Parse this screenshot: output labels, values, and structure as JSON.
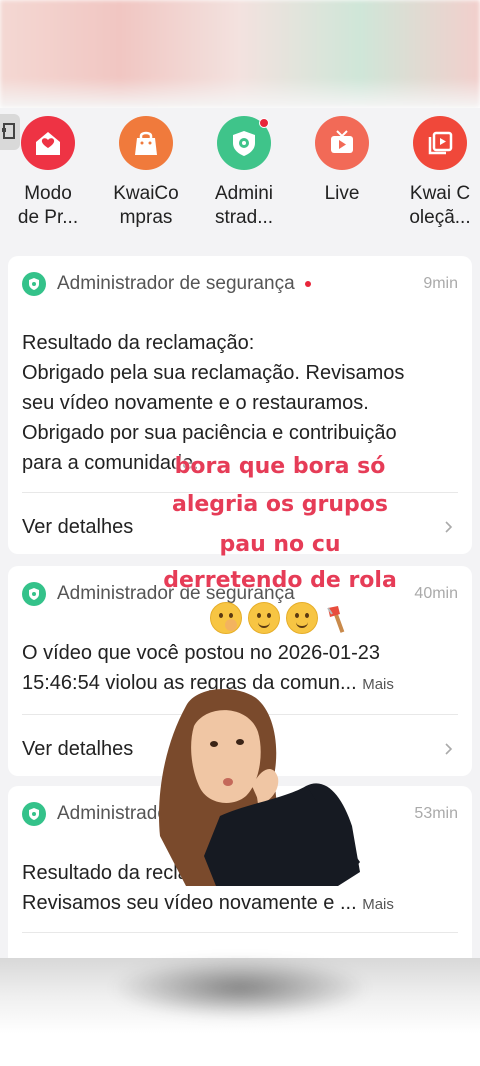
{
  "apps": [
    {
      "label": "Modo\nde Pr...",
      "icon": "home-shield-icon",
      "color": "#ee3344"
    },
    {
      "label": "KwaiCo\nmpras",
      "icon": "shopping-bag-icon",
      "color": "#f07a3c"
    },
    {
      "label": "Admini\nstrad...",
      "icon": "shield-icon",
      "color": "#3fc48a",
      "badge": true
    },
    {
      "label": "Live",
      "icon": "tv-icon",
      "color": "#f26a57"
    },
    {
      "label": "Kwai C\noleçã...",
      "icon": "video-collection-icon",
      "color": "#f0483a"
    }
  ],
  "cards": [
    {
      "title": "Administrador de segurança",
      "time": "9min",
      "unread": true,
      "body": [
        "Resultado da reclamação:",
        "Obrigado pela sua reclamação. Revisamos",
        "seu vídeo novamente e o restauramos.",
        "Obrigado por sua paciência e contribuição",
        "para a comunidade."
      ],
      "details": "Ver detalhes"
    },
    {
      "title": "Administrador de segurança",
      "time": "40min",
      "body": [
        "O vídeo que você postou no 2026-01-23",
        "15:46:54 violou as regras da comun"
      ],
      "more": "Mais",
      "details": "Ver detalhes"
    },
    {
      "title": "Administrador de segurança",
      "time": "53min",
      "body": [
        "Resultado da reclamação:",
        "Revisamos seu vídeo novamente e"
      ],
      "more": "Mais"
    }
  ],
  "overlay": {
    "lines": [
      "bora que bora só",
      "alegria os grupos",
      "pau no cu",
      "derretendo de rola"
    ],
    "color": "#e63c57",
    "emojis": [
      "hand-over-mouth-emoji",
      "thinking-emoji",
      "thinking-emoji",
      "axe-emoji"
    ]
  }
}
